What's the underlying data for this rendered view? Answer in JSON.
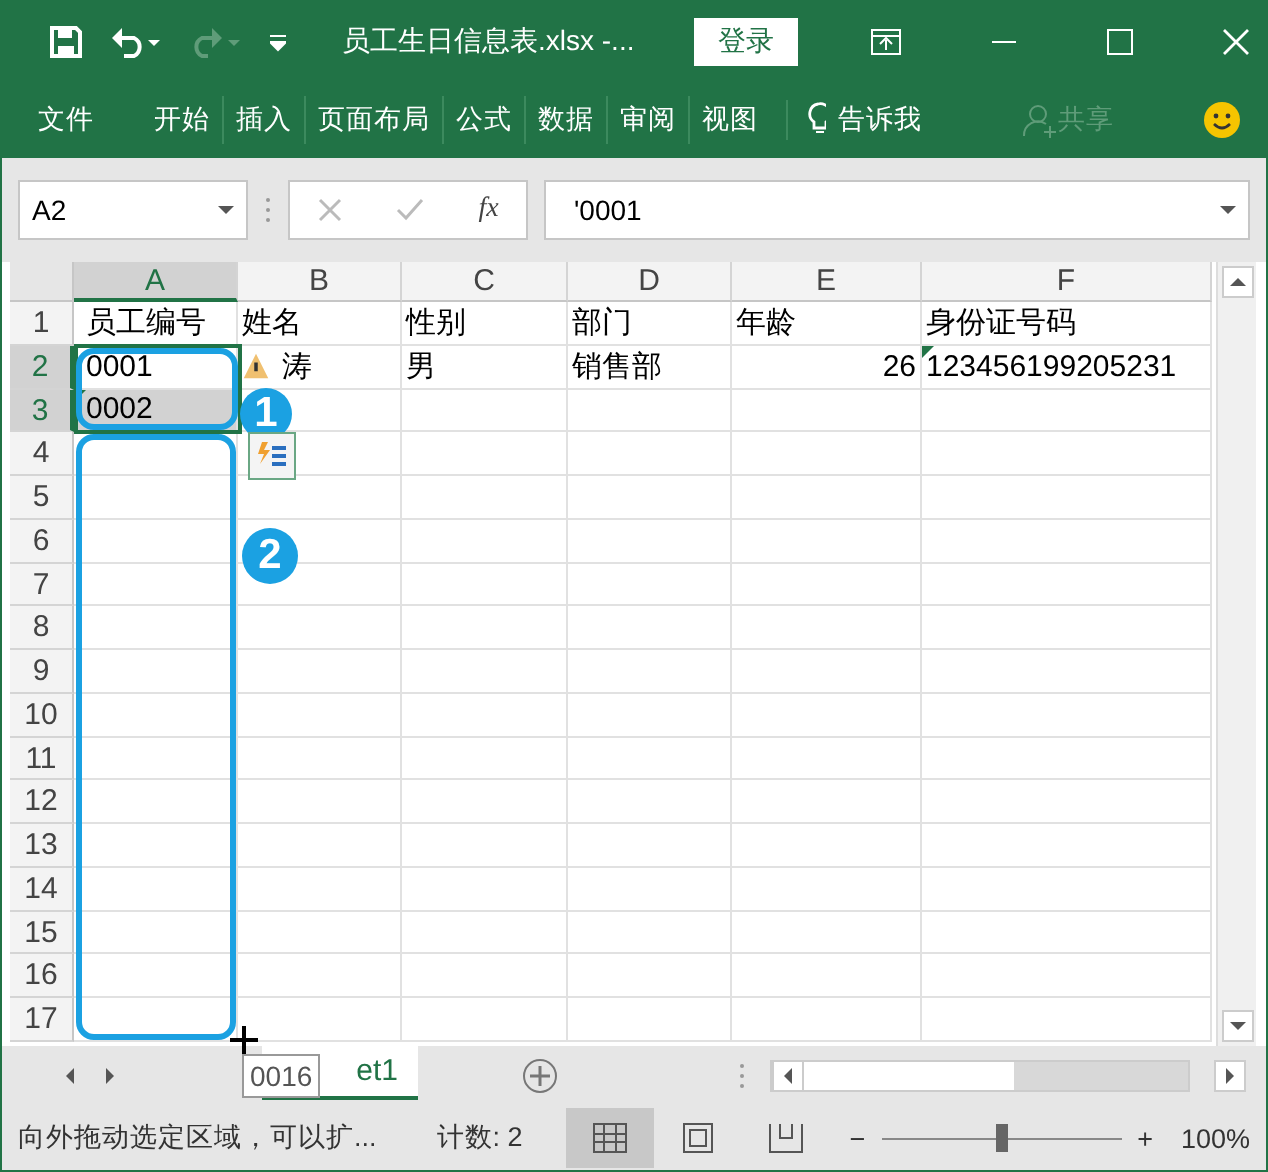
{
  "title_bar": {
    "title": "员工生日信息表.xlsx  -...",
    "login_button": "登录"
  },
  "ribbon_tabs": [
    {
      "label": "文件",
      "selected": false
    },
    {
      "label": "开始",
      "selected": false
    },
    {
      "label": "插入",
      "selected": false
    },
    {
      "label": "页面布局",
      "selected": false
    },
    {
      "label": "公式",
      "selected": false
    },
    {
      "label": "数据",
      "selected": false
    },
    {
      "label": "审阅",
      "selected": false
    },
    {
      "label": "视图",
      "selected": false
    }
  ],
  "tell_me": "告诉我",
  "share": {
    "label": "共享",
    "disabled": true
  },
  "formula_bar": {
    "name_box": "A2",
    "fx": "fx",
    "formula": "'0001"
  },
  "columns": [
    {
      "label": "A",
      "selected": true
    },
    {
      "label": "B",
      "selected": false
    },
    {
      "label": "C",
      "selected": false
    },
    {
      "label": "D",
      "selected": false
    },
    {
      "label": "E",
      "selected": false
    },
    {
      "label": "F",
      "selected": false
    }
  ],
  "rows": [
    {
      "number": "1",
      "selected": false,
      "cells": [
        {
          "text": "员工编号"
        },
        {
          "text": "姓名"
        },
        {
          "text": "性别"
        },
        {
          "text": "部门"
        },
        {
          "text": "年龄"
        },
        {
          "text": "身份证号码"
        }
      ]
    },
    {
      "number": "2",
      "selected": true,
      "cells": [
        {
          "text": "0001",
          "kind": "text"
        },
        {
          "text": "涛",
          "kind": "warning"
        },
        {
          "text": "男"
        },
        {
          "text": "销售部"
        },
        {
          "text": "26",
          "kind": "number"
        },
        {
          "text": "123456199205231",
          "kind": "flagged"
        }
      ]
    },
    {
      "number": "3",
      "selected": true,
      "cells": [
        {
          "text": "0002",
          "kind": "flagged",
          "selected": true
        },
        {},
        {},
        {},
        {},
        {}
      ]
    },
    {
      "number": "4",
      "selected": false
    },
    {
      "number": "5",
      "selected": false
    },
    {
      "number": "6",
      "selected": false
    },
    {
      "number": "7",
      "selected": false
    },
    {
      "number": "8",
      "selected": false
    },
    {
      "number": "9",
      "selected": false
    },
    {
      "number": "10",
      "selected": false
    },
    {
      "number": "11",
      "selected": false
    },
    {
      "number": "12",
      "selected": false
    },
    {
      "number": "13",
      "selected": false
    },
    {
      "number": "14",
      "selected": false
    },
    {
      "number": "15",
      "selected": false
    },
    {
      "number": "16",
      "selected": false
    },
    {
      "number": "17",
      "selected": false
    }
  ],
  "annotations": [
    {
      "label": "1"
    },
    {
      "label": "2"
    }
  ],
  "drag_tooltip": "0016",
  "sheet_tab": {
    "label": "et1",
    "selected": true
  },
  "status_bar": {
    "message": "向外拖动选定区域，可以扩...",
    "count": "计数: 2",
    "views": [
      {
        "kind": "normal",
        "selected": true
      },
      {
        "kind": "page-layout",
        "selected": false
      },
      {
        "kind": "page-break",
        "selected": false
      }
    ],
    "zoom": {
      "minus": "−",
      "plus": "+",
      "level": 0.5,
      "reading": "100%"
    }
  }
}
